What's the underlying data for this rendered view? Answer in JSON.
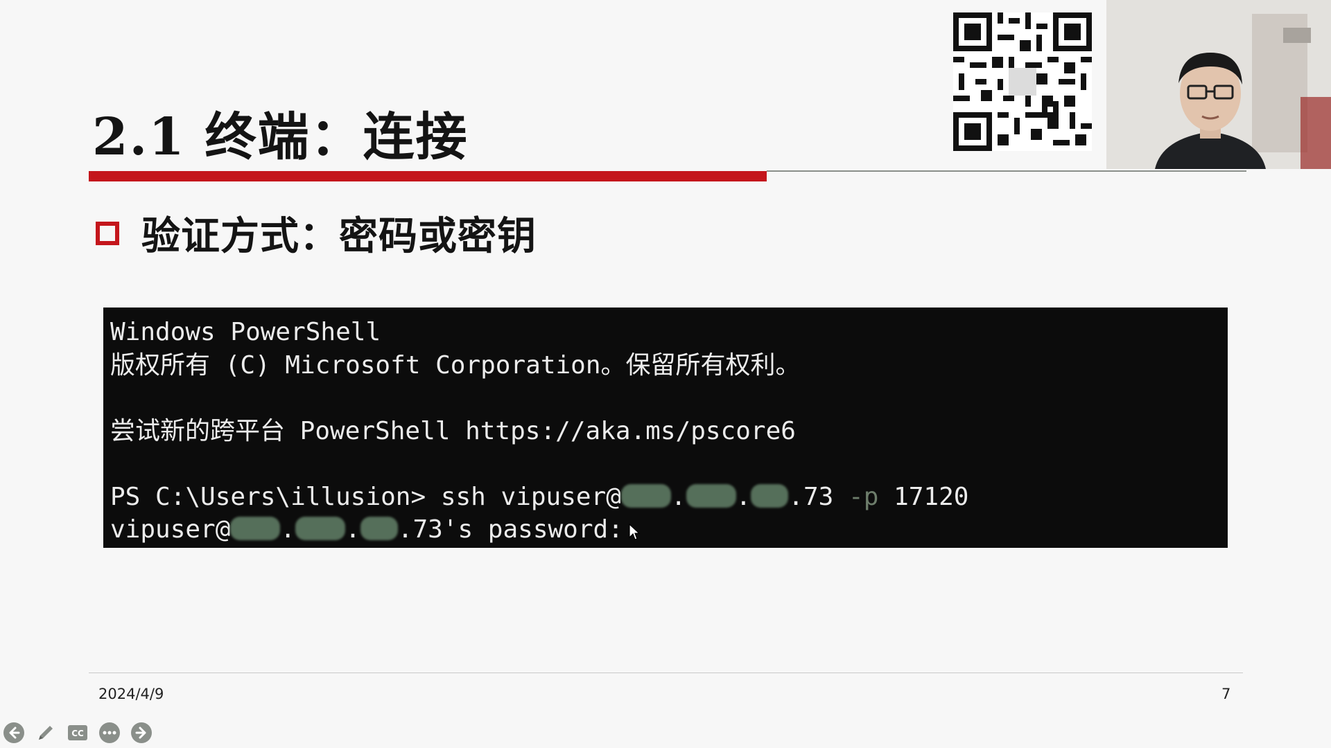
{
  "slide": {
    "title": "2.1 终端：连接",
    "bullet": "验证方式：密码或密钥",
    "date": "2024/4/9",
    "page_number": "7"
  },
  "terminal": {
    "line1": "Windows PowerShell",
    "line2": "版权所有 (C) Microsoft Corporation。保留所有权利。",
    "line3": "尝试新的跨平台 PowerShell https://aka.ms/pscore6",
    "prompt_prefix": "PS C:\\Users\\illusion> ssh vipuser@",
    "prompt_ip_tail": ".73",
    "prompt_flag": "-p",
    "prompt_port": "17120",
    "password_user": "vipuser@",
    "password_ip_tail": ".73's password:"
  },
  "colors": {
    "accent_red": "#c4161c",
    "terminal_bg": "#0c0c0c",
    "terminal_text": "#ececec",
    "redaction": "#5e7a63"
  },
  "icons": {
    "qr": "qr-code",
    "webcam": "presenter-webcam",
    "controls": [
      "arrow-left-icon",
      "pen-icon",
      "cc-icon",
      "more-icon",
      "arrow-right-icon"
    ]
  },
  "controls": {
    "cc_label": "CC"
  }
}
